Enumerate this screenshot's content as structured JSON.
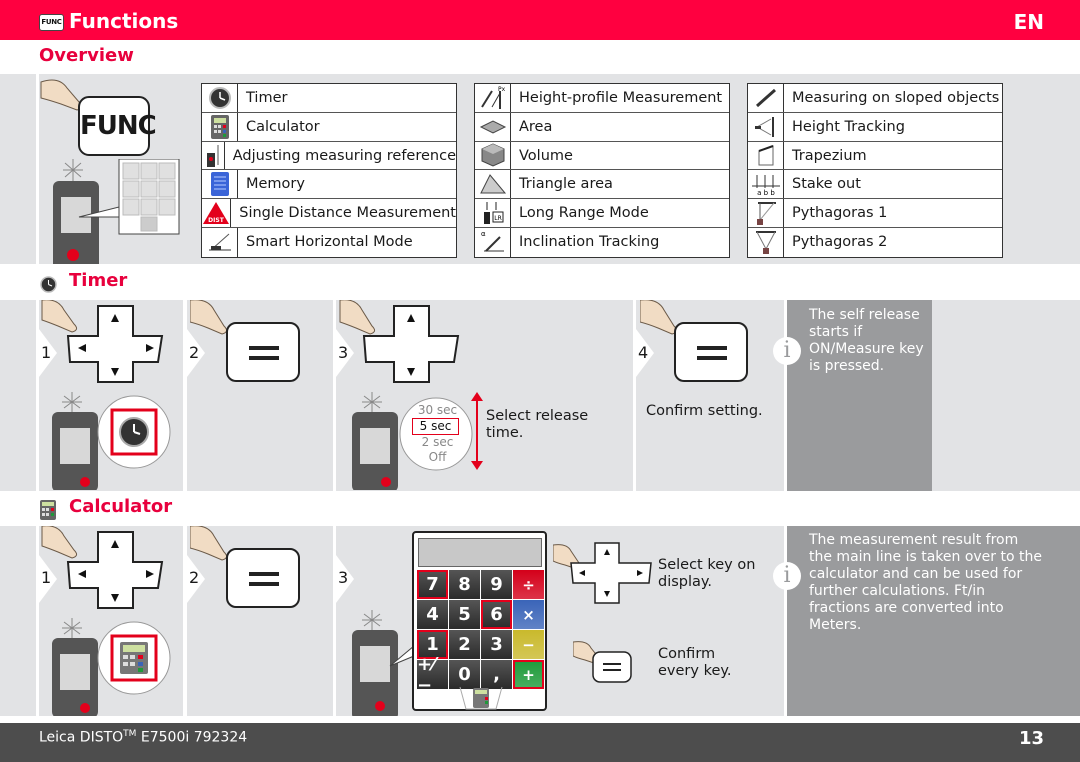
{
  "header": {
    "badge": "FUNC",
    "title": "Functions",
    "language": "EN",
    "accent_color": "#ff0040"
  },
  "overview": {
    "title": "Overview",
    "func_key_label": "FUNC",
    "columns": [
      [
        {
          "icon": "timer-icon",
          "label": "Timer"
        },
        {
          "icon": "calculator-icon",
          "label": "Calculator"
        },
        {
          "icon": "measuring-reference-icon",
          "label": "Adjusting measuring reference"
        },
        {
          "icon": "memory-icon",
          "label": "Memory"
        },
        {
          "icon": "single-distance-icon",
          "label": "Single Distance Measurement",
          "icon_text": "DIST"
        },
        {
          "icon": "smart-horizontal-icon",
          "label": "Smart Horizontal Mode"
        }
      ],
      [
        {
          "icon": "height-profile-icon",
          "label": "Height-profile Measurement"
        },
        {
          "icon": "area-icon",
          "label": "Area"
        },
        {
          "icon": "volume-icon",
          "label": "Volume"
        },
        {
          "icon": "triangle-area-icon",
          "label": "Triangle area"
        },
        {
          "icon": "long-range-icon",
          "label": "Long Range Mode",
          "icon_text": "LR"
        },
        {
          "icon": "inclination-tracking-icon",
          "label": "Inclination Tracking"
        }
      ],
      [
        {
          "icon": "sloped-objects-icon",
          "label": "Measuring on sloped objects"
        },
        {
          "icon": "height-tracking-icon",
          "label": "Height Tracking"
        },
        {
          "icon": "trapezium-icon",
          "label": "Trapezium"
        },
        {
          "icon": "stake-out-icon",
          "label": "Stake out",
          "icon_text": "a b b"
        },
        {
          "icon": "pythagoras-1-icon",
          "label": "Pythagoras 1"
        },
        {
          "icon": "pythagoras-2-icon",
          "label": "Pythagoras 2"
        }
      ]
    ]
  },
  "timer": {
    "title": "Timer",
    "steps": [
      {
        "num": "1"
      },
      {
        "num": "2"
      },
      {
        "num": "3",
        "options": [
          "30 sec",
          "5 sec",
          "2 sec",
          "Off"
        ],
        "selected": "5 sec",
        "text": "Select release time."
      },
      {
        "num": "4",
        "text": "Confirm setting."
      }
    ],
    "info": "The self release starts if ON/Measure key is pressed."
  },
  "calculator": {
    "title": "Calculator",
    "steps": [
      {
        "num": "1"
      },
      {
        "num": "2"
      },
      {
        "num": "3"
      }
    ],
    "keys": [
      {
        "label": "7",
        "selected": true
      },
      {
        "label": "8"
      },
      {
        "label": "9"
      },
      {
        "label": "÷",
        "color": "#d4001a"
      },
      {
        "label": "4"
      },
      {
        "label": "5"
      },
      {
        "label": "6",
        "selected": true
      },
      {
        "label": "×",
        "color": "#3a64b8"
      },
      {
        "label": "1",
        "selected": true
      },
      {
        "label": "2"
      },
      {
        "label": "3"
      },
      {
        "label": "−",
        "color": "#c9b92c"
      },
      {
        "label": "+⁄−"
      },
      {
        "label": "0"
      },
      {
        "label": ","
      },
      {
        "label": "+",
        "color": "#1e9a3a",
        "selected": true
      }
    ],
    "select_text": "Select key on display.",
    "confirm_text": "Confirm every key.",
    "info": "The measurement result from the main line is taken over to the calculator and can be used for further calculations. Ft/in fractions are converted into Meters."
  },
  "footer": {
    "product": "Leica DISTO",
    "tm": "TM",
    "model": "E7500i 792324",
    "page": "13"
  }
}
